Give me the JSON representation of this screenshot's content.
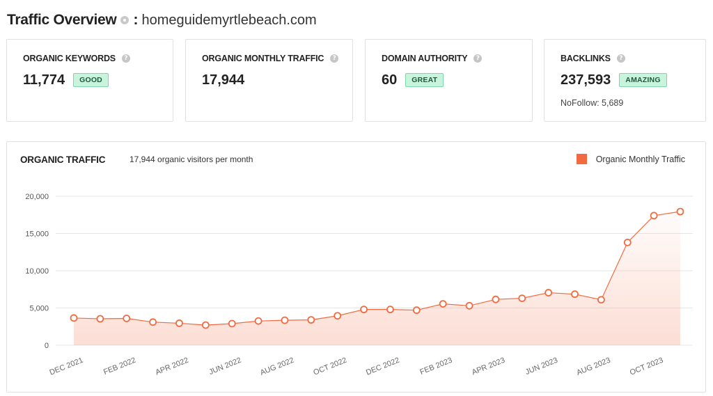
{
  "header": {
    "title": "Traffic Overview",
    "colon": ":",
    "domain": "homeguidemyrtlebeach.com"
  },
  "cards": [
    {
      "label": "ORGANIC KEYWORDS",
      "value": "11,774",
      "badge": "GOOD"
    },
    {
      "label": "ORGANIC MONTHLY TRAFFIC",
      "value": "17,944"
    },
    {
      "label": "DOMAIN AUTHORITY",
      "value": "60",
      "badge": "GREAT"
    },
    {
      "label": "BACKLINKS",
      "value": "237,593",
      "badge": "AMAZING",
      "sub": "NoFollow: 5,689"
    }
  ],
  "colors": {
    "accent": "#f26a3f",
    "badge_bg": "#c8f4dd",
    "badge_border": "#7fd7a8"
  },
  "chart_data": {
    "type": "area",
    "title": "ORGANIC TRAFFIC",
    "subtitle": "17,944 organic visitors per month",
    "legend": {
      "label": "Organic Monthly Traffic",
      "placement": "top-right"
    },
    "x": [
      "DEC 2021",
      "JAN 2022",
      "FEB 2022",
      "MAR 2022",
      "APR 2022",
      "MAY 2022",
      "JUN 2022",
      "JUL 2022",
      "AUG 2022",
      "SEP 2022",
      "OCT 2022",
      "NOV 2022",
      "DEC 2022",
      "JAN 2023",
      "FEB 2023",
      "MAR 2023",
      "APR 2023",
      "MAY 2023",
      "JUN 2023",
      "JUL 2023",
      "AUG 2023",
      "SEP 2023",
      "OCT 2023",
      "NOV 2023"
    ],
    "x_tick_labels": [
      "DEC 2021",
      "FEB 2022",
      "APR 2022",
      "JUN 2022",
      "AUG 2022",
      "OCT 2022",
      "DEC 2022",
      "FEB 2023",
      "APR 2023",
      "JUN 2023",
      "AUG 2023",
      "OCT 2023"
    ],
    "series": [
      {
        "name": "Organic Monthly Traffic",
        "values": [
          3650,
          3550,
          3600,
          3100,
          2950,
          2700,
          2900,
          3250,
          3350,
          3400,
          3950,
          4800,
          4800,
          4700,
          5550,
          5300,
          6150,
          6300,
          7050,
          6850,
          6100,
          13800,
          17400,
          17944
        ]
      }
    ],
    "y_ticks": [
      0,
      5000,
      10000,
      15000,
      20000
    ],
    "y_tick_labels": [
      "0",
      "5,000",
      "10,000",
      "15,000",
      "20,000"
    ],
    "ylim": [
      0,
      20000
    ],
    "grid": true
  }
}
